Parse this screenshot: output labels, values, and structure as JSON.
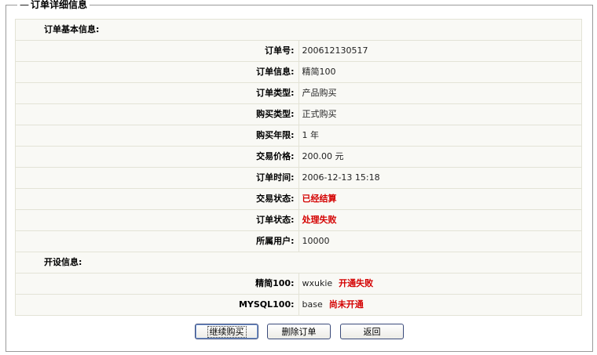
{
  "panel": {
    "title": "订单详细信息"
  },
  "basic": {
    "section_label": "订单基本信息:",
    "rows": [
      {
        "label": "订单号:",
        "value": "200612130517"
      },
      {
        "label": "订单信息:",
        "value": "精简100"
      },
      {
        "label": "订单类型:",
        "value": "产品购买"
      },
      {
        "label": "购买类型:",
        "value": "正式购买"
      },
      {
        "label": "购买年限:",
        "value": "1 年"
      },
      {
        "label": "交易价格:",
        "value": "200.00 元"
      },
      {
        "label": "订单时间:",
        "value": "2006-12-13 15:18"
      },
      {
        "label": "交易状态:",
        "value": "已经结算"
      },
      {
        "label": "订单状态:",
        "value": "处理失败"
      },
      {
        "label": "所属用户:",
        "value": "10000"
      }
    ]
  },
  "provision": {
    "section_label": "开设信息:",
    "rows": [
      {
        "label": "精简100:",
        "name": "wxukie",
        "status": "开通失败"
      },
      {
        "label": "MYSQL100:",
        "name": "base",
        "status": "尚未开通"
      }
    ]
  },
  "buttons": {
    "continue": "继续购买",
    "delete": "删除订单",
    "back": "返回"
  },
  "colors": {
    "status_red": "#d40000",
    "cell_bg": "#f9f9f5",
    "cell_border": "#e3e3d6"
  }
}
